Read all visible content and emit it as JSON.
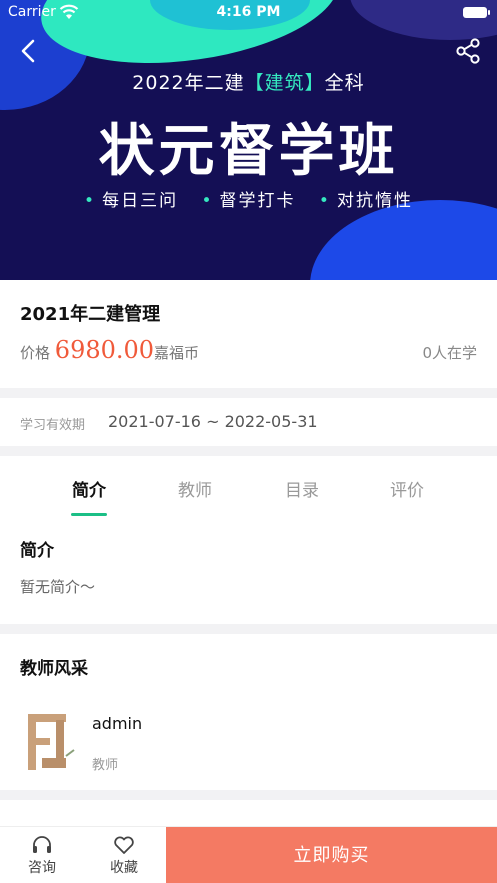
{
  "status_bar": {
    "carrier": "Carrier",
    "time": "4:16 PM"
  },
  "banner": {
    "subtitle_prefix": "2022年二建",
    "subtitle_highlight": "【建筑】",
    "subtitle_suffix": "全科",
    "title": "状元督学班",
    "points": [
      "每日三问",
      "督学打卡",
      "对抗惰性"
    ],
    "accent_color": "#35e9c0"
  },
  "course": {
    "title": "2021年二建管理",
    "price_label": "价格",
    "price": "6980.00",
    "currency": "嘉福币",
    "learners": "0人在学",
    "price_color": "#f05a3a"
  },
  "validity": {
    "label": "学习有效期",
    "value": "2021-07-16 ~ 2022-05-31"
  },
  "tabs": [
    {
      "label": "简介",
      "active": true
    },
    {
      "label": "教师",
      "active": false
    },
    {
      "label": "目录",
      "active": false
    },
    {
      "label": "评价",
      "active": false
    }
  ],
  "intro": {
    "heading": "简介",
    "text": "暂无简介～"
  },
  "teachers": {
    "heading": "教师风采",
    "items": [
      {
        "name": "admin",
        "role": "教师"
      }
    ]
  },
  "bottom_bar": {
    "consult_label": "咨询",
    "favorite_label": "收藏",
    "buy_label": "立即购买",
    "buy_color": "#f47a63"
  },
  "icons": [
    "back-icon",
    "share-icon",
    "wifi-icon",
    "battery-icon",
    "headset-icon",
    "heart-icon"
  ]
}
